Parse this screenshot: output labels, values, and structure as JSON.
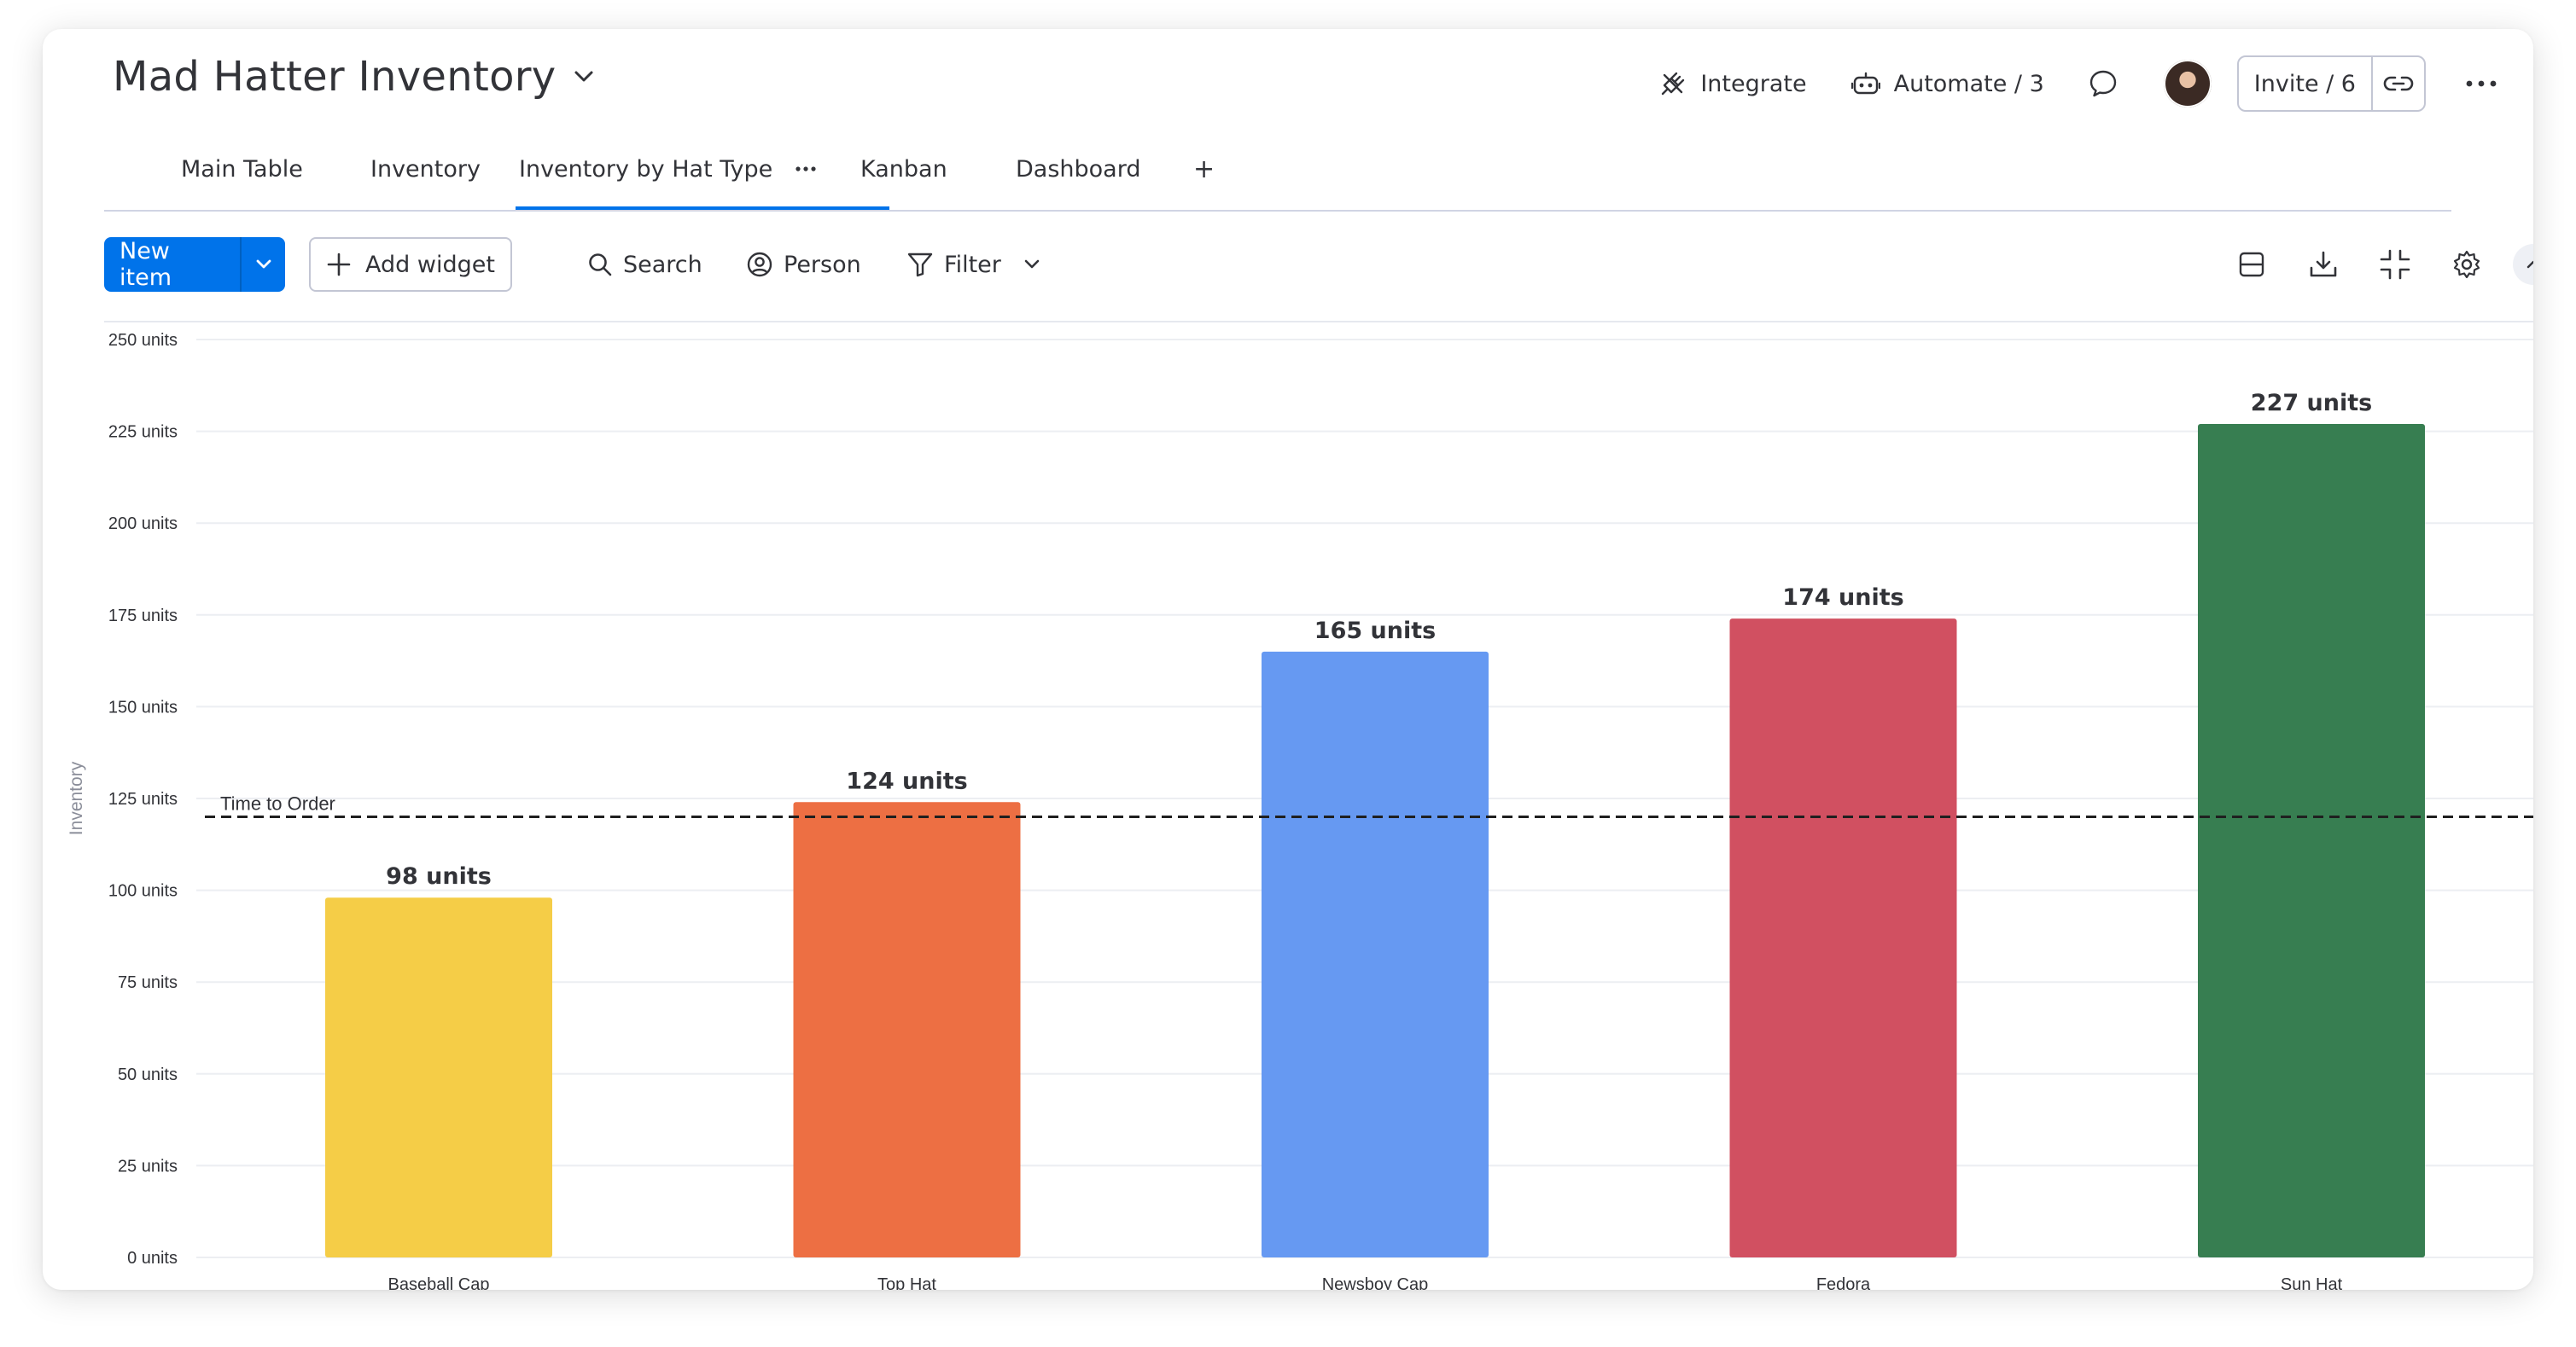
{
  "header": {
    "board_title": "Mad Hatter Inventory",
    "integrate_label": "Integrate",
    "automate_label": "Automate / 3",
    "invite_label": "Invite / 6"
  },
  "tabs": [
    {
      "label": "Main Table"
    },
    {
      "label": "Inventory"
    },
    {
      "label": "Inventory by Hat Type"
    },
    {
      "label": "Kanban"
    },
    {
      "label": "Dashboard"
    }
  ],
  "add_tab_label": "+",
  "toolbar": {
    "new_item_label": "New item",
    "add_widget_label": "Add widget",
    "search_label": "Search",
    "person_label": "Person",
    "filter_label": "Filter"
  },
  "colors": {
    "primary": "#0073ea",
    "baseball_cap": "#f5cd47",
    "top_hat": "#ed6f43",
    "newsboy_cap": "#6699f2",
    "fedora": "#d15061",
    "sun_hat": "#377e51"
  },
  "icons": [
    "chevron-down-icon",
    "integrate-plug-icon",
    "robot-icon",
    "chat-bubble-icon",
    "link-icon",
    "more-dots-icon",
    "plus-icon",
    "search-icon",
    "person-icon",
    "filter-icon",
    "layout-icon",
    "download-icon",
    "collapse-arrows-icon",
    "settings-gear-icon",
    "chevron-up-icon"
  ],
  "chart_data": {
    "type": "bar",
    "categories": [
      "Baseball Cap",
      "Top Hat",
      "Newsboy Cap",
      "Fedora",
      "Sun Hat"
    ],
    "values": [
      98,
      124,
      165,
      174,
      227
    ],
    "value_labels": [
      "98 units",
      "124 units",
      "165 units",
      "174 units",
      "227 units"
    ],
    "colors": [
      "#f5cd47",
      "#ed6f43",
      "#6699f2",
      "#d15061",
      "#377e51"
    ],
    "ylabel": "Inventory",
    "ylim": [
      0,
      250
    ],
    "yticks": [
      0,
      25,
      50,
      75,
      100,
      125,
      150,
      175,
      200,
      225,
      250
    ],
    "ytick_labels": [
      "0 units",
      "25 units",
      "50 units",
      "75 units",
      "100 units",
      "125 units",
      "150 units",
      "175 units",
      "200 units",
      "225 units",
      "250 units"
    ],
    "reference_line": {
      "value": 120,
      "label": "Time to Order",
      "style": "dashed"
    },
    "grid": true
  }
}
